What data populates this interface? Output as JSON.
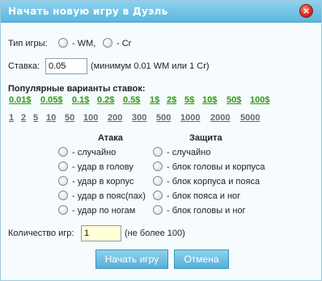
{
  "window": {
    "title": "Начать новую игру в Дуэль",
    "close_label": "×"
  },
  "game_type": {
    "label": "Тип игры:",
    "options": [
      "- WM,",
      "- Cr"
    ]
  },
  "stake": {
    "label": "Ставка:",
    "value": "0.05",
    "note": "(минимум 0.01 WM или 1 Cr)"
  },
  "popular": {
    "heading": "Популярные варианты ставок:",
    "bets": [
      "0.01$",
      "0.05$",
      "0.1$",
      "0.2$",
      "0.5$",
      "1$",
      "2$",
      "5$",
      "10$",
      "50$",
      "100$"
    ],
    "counts": [
      "1",
      "2",
      "5",
      "10",
      "50",
      "100",
      "200",
      "300",
      "500",
      "1000",
      "2000",
      "5000"
    ]
  },
  "attack": {
    "heading": "Атака",
    "options": [
      "- случайно",
      "- удар в голову",
      "- удар в корпус",
      "- удар в пояс(пах)",
      "- удар по ногам"
    ]
  },
  "defense": {
    "heading": "Защита",
    "options": [
      "- случайно",
      "- блок головы и корпуса",
      "- блок корпуса и пояса",
      "- блок пояса и ног",
      "- блок головы и ног"
    ]
  },
  "games_count": {
    "label": "Количество игр:",
    "value": "1",
    "note": "(не более 100)"
  },
  "buttons": {
    "start": "Начать игру",
    "cancel": "Отмена"
  },
  "colors": {
    "titlebar": "#5bb6de",
    "bet_link": "#2e9a10",
    "count_link": "#6a6a6a",
    "button": "#55afd9",
    "close": "#d5281c"
  }
}
